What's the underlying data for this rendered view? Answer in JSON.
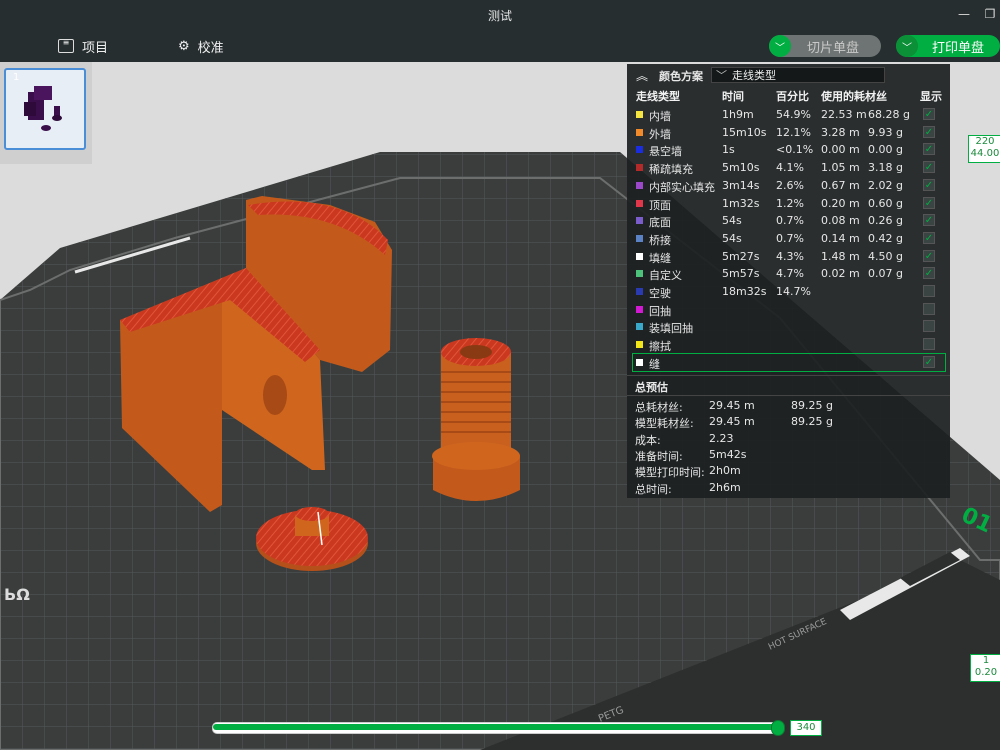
{
  "window": {
    "title": "测试"
  },
  "toolbar": {
    "project_label": "项目",
    "calibrate_label": "校准",
    "slice_plate_label": "切片单盘",
    "print_plate_label": "打印单盘"
  },
  "thumbnail": {
    "plate_number": "1"
  },
  "legend": {
    "title": "颜色方案",
    "scheme_value": "走线类型",
    "headers": {
      "type": "走线类型",
      "time": "时间",
      "percent": "百分比",
      "filament": "使用的耗材丝",
      "show": "显示"
    },
    "rows": [
      {
        "name": "内墙",
        "color": "#f4e542",
        "time": "1h9m",
        "percent": "54.9%",
        "length": "22.53 m",
        "weight": "68.28 g",
        "checked": true
      },
      {
        "name": "外墙",
        "color": "#f08a2a",
        "time": "15m10s",
        "percent": "12.1%",
        "length": "3.28 m",
        "weight": "9.93 g",
        "checked": true
      },
      {
        "name": "悬空墙",
        "color": "#1a2ee0",
        "time": "1s",
        "percent": "<0.1%",
        "length": "0.00 m",
        "weight": "0.00 g",
        "checked": true
      },
      {
        "name": "稀疏填充",
        "color": "#b22a2a",
        "time": "5m10s",
        "percent": "4.1%",
        "length": "1.05 m",
        "weight": "3.18 g",
        "checked": true
      },
      {
        "name": "内部实心填充",
        "color": "#9b49c9",
        "time": "3m14s",
        "percent": "2.6%",
        "length": "0.67 m",
        "weight": "2.02 g",
        "checked": true
      },
      {
        "name": "顶面",
        "color": "#e0384a",
        "time": "1m32s",
        "percent": "1.2%",
        "length": "0.20 m",
        "weight": "0.60 g",
        "checked": true
      },
      {
        "name": "底面",
        "color": "#7a5ccb",
        "time": "54s",
        "percent": "0.7%",
        "length": "0.08 m",
        "weight": "0.26 g",
        "checked": true
      },
      {
        "name": "桥接",
        "color": "#5b82c4",
        "time": "54s",
        "percent": "0.7%",
        "length": "0.14 m",
        "weight": "0.42 g",
        "checked": true
      },
      {
        "name": "填缝",
        "color": "#ffffff",
        "time": "5m27s",
        "percent": "4.3%",
        "length": "1.48 m",
        "weight": "4.50 g",
        "checked": true
      },
      {
        "name": "自定义",
        "color": "#4cc27a",
        "time": "5m57s",
        "percent": "4.7%",
        "length": "0.02 m",
        "weight": "0.07 g",
        "checked": true
      },
      {
        "name": "空驶",
        "color": "#2a3ab0",
        "time": "18m32s",
        "percent": "14.7%",
        "length": "",
        "weight": "",
        "checked": false
      },
      {
        "name": "回抽",
        "color": "#d21ad2",
        "time": "",
        "percent": "",
        "length": "",
        "weight": "",
        "checked": false
      },
      {
        "name": "装填回抽",
        "color": "#3aa8c8",
        "time": "",
        "percent": "",
        "length": "",
        "weight": "",
        "checked": false
      },
      {
        "name": "擦拭",
        "color": "#f0e61a",
        "time": "",
        "percent": "",
        "length": "",
        "weight": "",
        "checked": false
      },
      {
        "name": "缝",
        "color": "#ffffff",
        "time": "",
        "percent": "",
        "length": "",
        "weight": "",
        "checked": true
      }
    ],
    "summary_title": "总预估",
    "summary": [
      {
        "label": "总耗材丝:",
        "v1": "29.45 m",
        "v2": "89.25 g"
      },
      {
        "label": "模型耗材丝:",
        "v1": "29.45 m",
        "v2": "89.25 g"
      },
      {
        "label": "成本:",
        "v1": "2.23",
        "v2": ""
      },
      {
        "label": "准备时间:",
        "v1": "5m42s",
        "v2": ""
      },
      {
        "label": "模型打印时间:",
        "v1": "2h0m",
        "v2": ""
      },
      {
        "label": "总时间:",
        "v1": "2h6m",
        "v2": ""
      }
    ]
  },
  "layer_ruler": {
    "top_layer": "220",
    "top_height": "44.00",
    "bottom_layer": "1",
    "bottom_height": "0.20"
  },
  "plate": {
    "corner_text": "01",
    "hot_surface_text": "HOT SURFACE",
    "material_text": "PETG"
  },
  "move_slider": {
    "value": "340",
    "progress": 1.0
  },
  "colors": {
    "accent": "#00ae42",
    "model": "#c9601e",
    "model_top": "#d23a2e",
    "plate": "#3b3d3d"
  }
}
